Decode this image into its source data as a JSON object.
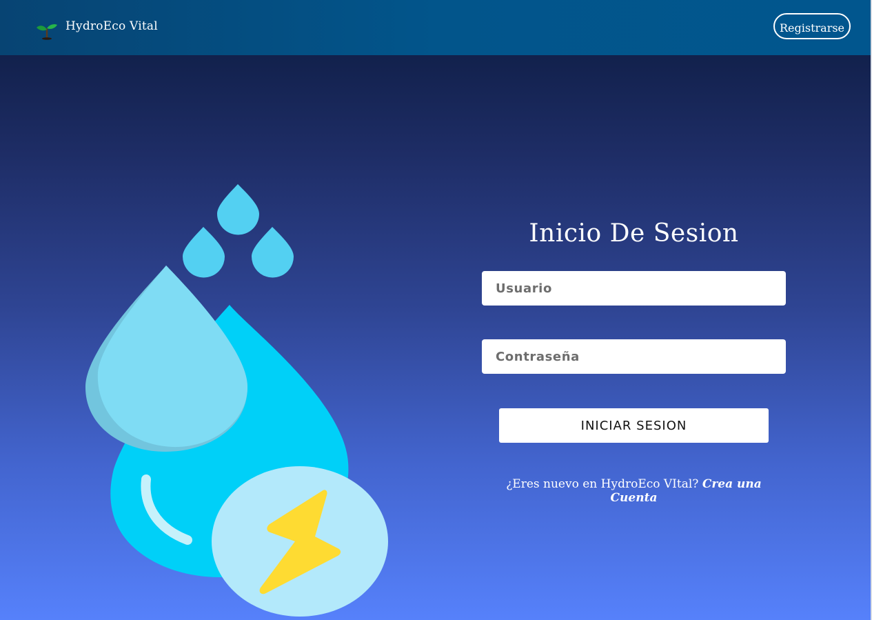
{
  "navbar": {
    "brand_name": "HydroEco Vital",
    "brand_icon": "seedling-icon",
    "register_label": "Registrarse"
  },
  "illustration": {
    "icon": "water-drops-energy-icon"
  },
  "login": {
    "title": "Inicio De Sesion",
    "username_placeholder": "Usuario",
    "username_value": "",
    "password_placeholder": "Contraseña",
    "password_value": "",
    "submit_label": "INICIAR SESION",
    "signup_prompt": "¿Eres nuevo en HydroEco VItal?",
    "signup_link": "Crea una Cuenta"
  },
  "colors": {
    "navbar_bg": "#02558b",
    "page_gradient_top": "#0b1a3e",
    "page_gradient_bottom": "#5681fb",
    "drop_main": "#00d0f8",
    "drop_light": "#7fdcf4",
    "drop_small": "#53d0f2",
    "badge_circle": "#b3e9fb",
    "lightning": "#fedb32"
  }
}
